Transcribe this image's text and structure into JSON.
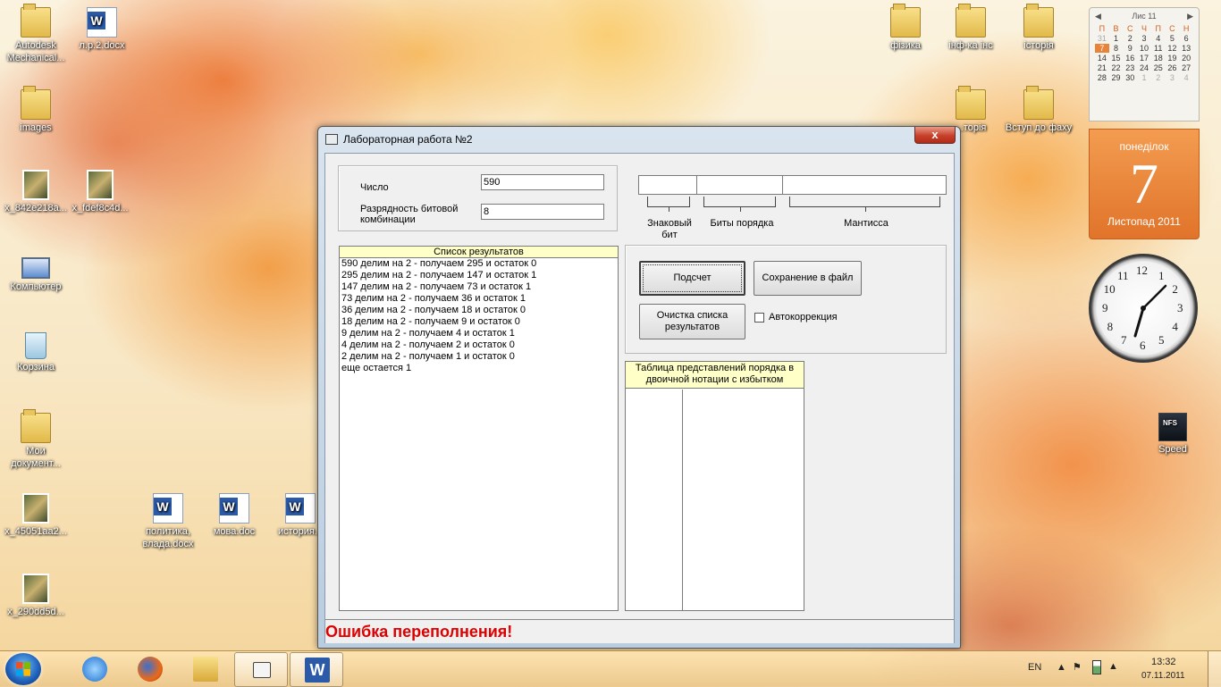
{
  "desktop": {
    "icons": [
      {
        "label": "Autodesk Mechanical...",
        "icon": "folder-icon"
      },
      {
        "label": "л.р.2.docx",
        "icon": "word-document-icon"
      },
      {
        "label": "images",
        "icon": "folder-icon"
      },
      {
        "label": "x_842e218a...",
        "icon": "image-file-icon"
      },
      {
        "label": "x_fdef8c4d...",
        "icon": "image-file-icon"
      },
      {
        "label": "Компьютер",
        "icon": "computer-icon"
      },
      {
        "label": "Корзина",
        "icon": "recycle-bin-icon"
      },
      {
        "label": "Мои документ...",
        "icon": "documents-shortcut-icon"
      },
      {
        "label": "x_45051aa2...",
        "icon": "image-file-icon"
      },
      {
        "label": "x_290dd5d...",
        "icon": "image-file-icon"
      },
      {
        "label": "политика, влада.docx",
        "icon": "word-document-icon"
      },
      {
        "label": "мова.doc",
        "icon": "word-document-icon"
      },
      {
        "label": "история...",
        "icon": "word-document-icon"
      },
      {
        "label": "фізика",
        "icon": "folder-icon"
      },
      {
        "label": "інф-ка інс",
        "icon": "folder-icon"
      },
      {
        "label": "історія",
        "icon": "folder-icon"
      },
      {
        "label": "...торія",
        "icon": "folder-icon"
      },
      {
        "label": "Вступ до фаху",
        "icon": "folder-icon"
      },
      {
        "label": "Speed",
        "icon": "game-shortcut-icon"
      }
    ]
  },
  "calendar": {
    "month_short": "Лис 11",
    "weekdays": [
      "П",
      "В",
      "С",
      "Ч",
      "П",
      "С",
      "Н"
    ],
    "weeks": [
      [
        "31",
        "1",
        "2",
        "3",
        "4",
        "5",
        "6"
      ],
      [
        "7",
        "8",
        "9",
        "10",
        "11",
        "12",
        "13"
      ],
      [
        "14",
        "15",
        "16",
        "17",
        "18",
        "19",
        "20"
      ],
      [
        "21",
        "22",
        "23",
        "24",
        "25",
        "26",
        "27"
      ],
      [
        "28",
        "29",
        "30",
        "1",
        "2",
        "3",
        "4"
      ]
    ],
    "weekday_name": "понеділок",
    "day": "7",
    "month_year": "Листопад 2011"
  },
  "clock": {
    "numbers": [
      "12",
      "1",
      "2",
      "3",
      "4",
      "5",
      "6",
      "7",
      "8",
      "9",
      "10",
      "11"
    ]
  },
  "window": {
    "title": "Лабораторная работа №2",
    "close_glyph": "x",
    "number_label": "Число",
    "number_value": "590",
    "bits_label": "Разрядность битовой комбинации",
    "bits_value": "8",
    "sign_label": "Знаковый бит",
    "exponent_label": "Биты порядка",
    "mantissa_label": "Мантисса",
    "results_header": "Список результатов",
    "results": [
      "590 делим на 2 - получаем 295 и остаток 0",
      "295 делим на 2 - получаем 147 и остаток 1",
      "147 делим на 2 - получаем 73 и остаток 1",
      "73 делим на 2 - получаем 36 и остаток 1",
      "36 делим на 2 - получаем 18 и остаток 0",
      "18 делим на 2 - получаем 9 и остаток 0",
      "9 делим на 2 - получаем 4 и остаток 1",
      "4 делим на 2 - получаем 2 и остаток 0",
      "2 делим на 2 - получаем 1 и остаток 0",
      "еще остается 1"
    ],
    "calc_button": "Подсчет",
    "save_button": "Сохранение в файл",
    "clear_button": "Очистка списка результатов",
    "autocorrect_label": "Автокоррекция",
    "autocorrect_checked": false,
    "table_header": "Таблица представлений порядка в двоичной нотации с избытком",
    "status_error": "Ошибка переполнения!",
    "error_color": "#e00000"
  },
  "taskbar": {
    "language": "EN",
    "time": "13:32",
    "date": "07.11.2011",
    "apps": [
      "start-icon",
      "internet-explorer-icon",
      "firefox-icon",
      "explorer-icon",
      "program-window-icon",
      "word-icon"
    ]
  }
}
